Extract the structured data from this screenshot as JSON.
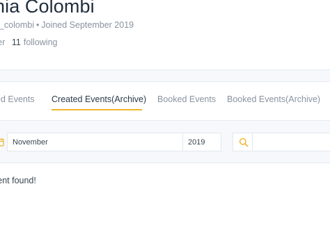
{
  "profile": {
    "name": "nia Colombi",
    "username": "a_colombi",
    "joined": "Joined September 2019",
    "followers_label": "ver",
    "following_count": "11",
    "following_label": "following"
  },
  "tabs": [
    {
      "label": "ed Events",
      "active": false
    },
    {
      "label": "Created Events(Archive)",
      "active": true
    },
    {
      "label": "Booked Events",
      "active": false
    },
    {
      "label": "Booked Events(Archive)",
      "active": false
    }
  ],
  "filters": {
    "month": "November",
    "year": "2019",
    "search_value": ""
  },
  "empty_message": "vent found!",
  "colors": {
    "accent": "#f0b429",
    "band_bg": "#f6f8fb",
    "muted_text": "#8a93a0"
  }
}
